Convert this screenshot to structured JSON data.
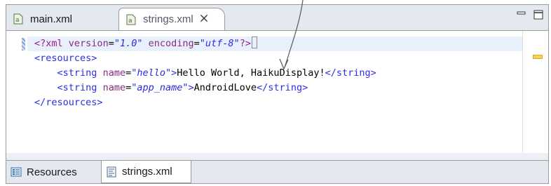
{
  "tabs": {
    "main": {
      "label": "main.xml",
      "icon": "xml-file-icon"
    },
    "strings": {
      "label": "strings.xml",
      "icon": "xml-file-icon",
      "close_icon": "close-icon"
    }
  },
  "window_controls": {
    "minimize_icon": "minimize-icon",
    "maximize_icon": "maximize-icon"
  },
  "code": {
    "line1": {
      "open": "<?",
      "tag": "xml",
      "attr1": "version",
      "eq1": "=",
      "val1": "\"1.0\"",
      "attr2": "encoding",
      "eq2": "=",
      "val2": "\"utf-8\"",
      "close": "?>"
    },
    "line2": {
      "text": "<resources>"
    },
    "line3": {
      "open": "<string",
      "attr": "name",
      "eq": "=",
      "val": "\"hello\"",
      "gt": ">",
      "content": "Hello World, HaikuDisplay!",
      "end": "</string>"
    },
    "line4": {
      "open": "<string",
      "attr": "name",
      "eq": "=",
      "val": "\"app_name\"",
      "gt": ">",
      "content": "AndroidLove",
      "end": "</string>"
    },
    "line5": {
      "text": "</resources>"
    }
  },
  "bottom_tabs": {
    "resources": {
      "label": "Resources",
      "icon": "resources-form-icon"
    },
    "strings": {
      "label": "strings.xml",
      "icon": "source-file-icon"
    }
  },
  "colors": {
    "tag": "#2d2de6",
    "processing_instruction": "#9b1d8a",
    "attribute": "#8a2a80",
    "value": "#2a2ae0",
    "current_line": "#e8f0fb",
    "overview_marker": "#f5d25b"
  }
}
